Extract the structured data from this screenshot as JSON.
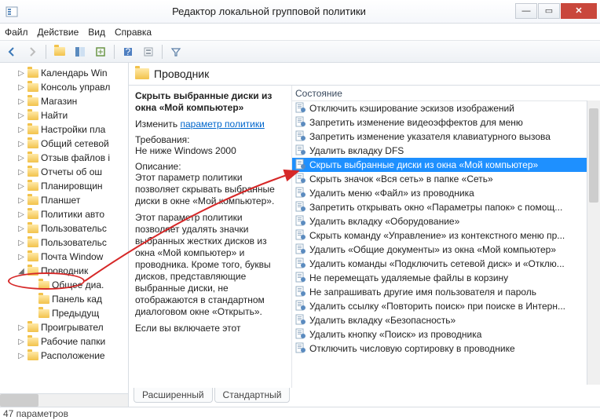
{
  "window": {
    "title": "Редактор локальной групповой политики"
  },
  "menu": {
    "file": "Файл",
    "action": "Действие",
    "view": "Вид",
    "help": "Справка"
  },
  "tree": [
    "Календарь Win",
    "Консоль управл",
    "Магазин",
    "Найти",
    "Настройки пла",
    "Общий сетевой",
    "Отзыв файлов і",
    "Отчеты об ош",
    "Планировщин",
    "Планшет",
    "Политики авто",
    "Пользовательс",
    "Пользовательс",
    "Почта Window",
    "Проводник",
    "Общее диа.",
    "Панель кад",
    "Предыдущ",
    "Проигрывател",
    "Рабочие папки",
    "Расположение"
  ],
  "header": {
    "title": "Проводник"
  },
  "desc": {
    "title": "Скрыть выбранные диски из окна «Мой компьютер»",
    "change_label": "Изменить",
    "policy_link": "параметр политики",
    "req_label": "Требования:",
    "req_value": "Не ниже Windows 2000",
    "desc_label": "Описание:",
    "p1": "Этот параметр политики позволяет скрывать выбранные диски в окне «Мой компьютер».",
    "p2": "Этот параметр политики позволяет удалять значки выбранных жестких дисков из окна «Мой компьютер» и проводника. Кроме того, буквы дисков, представляющие выбранные диски, не отображаются в стандартном диалоговом окне «Открыть».",
    "p3": "Если вы включаете этот"
  },
  "list": {
    "header": "Состояние",
    "items": [
      "Отключить кэширование эскизов изображений",
      "Запретить изменение видеоэффектов для меню",
      "Запретить изменение указателя клавиатурного вызова",
      "Удалить вкладку DFS",
      "Скрыть выбранные диски из окна «Мой компьютер»",
      "Скрыть значок «Вся сеть» в папке «Сеть»",
      "Удалить меню «Файл» из проводника",
      "Запретить открывать окно «Параметры папок» с помощ...",
      "Удалить вкладку «Оборудование»",
      "Скрыть команду «Управление» из контекстного меню пр...",
      "Удалить «Общие документы» из окна «Мой компьютер»",
      "Удалить команды «Подключить сетевой диск» и «Отклю...",
      "Не перемещать удаляемые файлы в корзину",
      "Не запрашивать другие имя пользователя и пароль",
      "Удалить ссылку «Повторить поиск» при поиске в Интерн...",
      "Удалить вкладку «Безопасность»",
      "Удалить кнопку «Поиск» из проводника",
      "Отключить числовую сортировку в проводнике"
    ],
    "selected_index": 4
  },
  "tabs": {
    "extended": "Расширенный",
    "standard": "Стандартный"
  },
  "status": {
    "count": "47 параметров"
  }
}
